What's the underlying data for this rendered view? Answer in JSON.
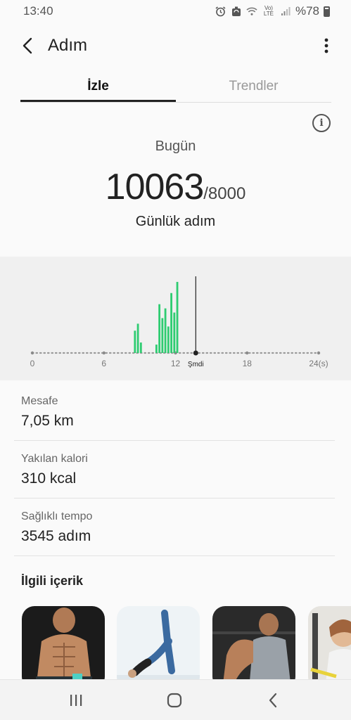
{
  "status_bar": {
    "time": "13:40",
    "battery_text": "%78",
    "network": "Vo) LTE",
    "icons": [
      "alarm-icon",
      "sync-icon",
      "wifi-icon",
      "signal-icon",
      "battery-icon"
    ]
  },
  "app_bar": {
    "title": "Adım",
    "icons": [
      "back-arrow-icon",
      "more-vert-icon"
    ]
  },
  "tabs": [
    {
      "label": "İzle",
      "active": true
    },
    {
      "label": "Trendler",
      "active": false
    }
  ],
  "summary": {
    "info_icon": "info-icon",
    "period": "Bugün",
    "steps": "10063",
    "goal": "/8000",
    "label": "Günlük adım"
  },
  "chart_data": {
    "type": "bar",
    "xlabel": "",
    "ylabel": "",
    "x_ticks": [
      "0",
      "6",
      "12",
      "Şmdi",
      "18",
      "24(s)"
    ],
    "x_tick_values": [
      0,
      6,
      12,
      13.7,
      18,
      24
    ],
    "xlim": [
      0,
      24
    ],
    "now_hour": 13.7,
    "bars": [
      {
        "x": 8.6,
        "value": 32
      },
      {
        "x": 8.85,
        "value": 42
      },
      {
        "x": 9.1,
        "value": 15
      },
      {
        "x": 10.4,
        "value": 12
      },
      {
        "x": 10.65,
        "value": 70
      },
      {
        "x": 10.9,
        "value": 50
      },
      {
        "x": 11.15,
        "value": 64
      },
      {
        "x": 11.4,
        "value": 38
      },
      {
        "x": 11.65,
        "value": 86
      },
      {
        "x": 11.9,
        "value": 58
      },
      {
        "x": 12.15,
        "value": 102
      }
    ],
    "ylim": [
      0,
      110
    ],
    "bar_color": "#2ecc71",
    "now_line_color": "#222222"
  },
  "metrics": [
    {
      "label": "Mesafe",
      "value": "7,05 km"
    },
    {
      "label": "Yakılan kalori",
      "value": "310 kcal"
    },
    {
      "label": "Sağlıklı tempo",
      "value": "3545 adım"
    }
  ],
  "related": {
    "title": "İlgili içerik",
    "cards": [
      {
        "image": "abs-fitness-photo"
      },
      {
        "image": "yoga-bridge-photo"
      },
      {
        "image": "gym-tanktop-photo"
      },
      {
        "image": "gym-woman-photo"
      }
    ]
  },
  "nav_bar": {
    "icons": [
      "recent-apps-icon",
      "home-icon",
      "back-icon"
    ]
  }
}
